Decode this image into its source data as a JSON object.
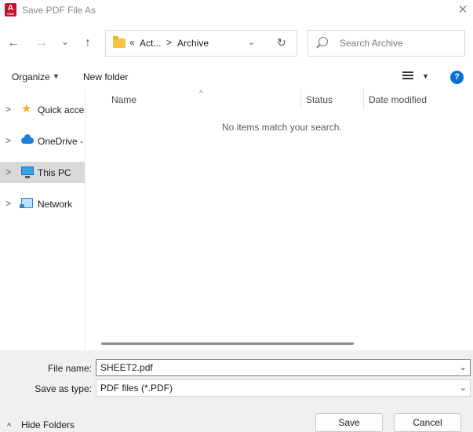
{
  "window": {
    "title": "Save PDF File As",
    "app_icon_letter": "A",
    "app_icon_sub": "CAD",
    "close_glyph": "✕"
  },
  "nav": {
    "back_glyph": "←",
    "forward_glyph": "→",
    "recent_glyph": "⌄",
    "up_glyph": "↑"
  },
  "address": {
    "overflow_glyph": "«",
    "crumb1": "Act...",
    "separator": ">",
    "crumb2": "Archive",
    "dropdown_glyph": "⌄",
    "refresh_glyph": "↻"
  },
  "search": {
    "placeholder": "Search Archive"
  },
  "toolbar": {
    "organize_label": "Organize",
    "caret": "▼",
    "new_folder_label": "New folder",
    "help_label": "?"
  },
  "sidebar": {
    "items": [
      {
        "label": "Quick access",
        "icon": "star-icon"
      },
      {
        "label": "OneDrive - ",
        "icon": "cloud-icon"
      },
      {
        "label": "This PC",
        "icon": "computer-icon",
        "selected": true
      },
      {
        "label": "Network",
        "icon": "network-icon"
      }
    ],
    "chevron_glyph": ">"
  },
  "filelist": {
    "columns": [
      "Name",
      "Status",
      "Date modified"
    ],
    "sort_glyph": "^",
    "empty_message": "No items match your search."
  },
  "form": {
    "file_name_label": "File name:",
    "file_name_value": "SHEET2.pdf",
    "save_type_label": "Save as type:",
    "save_type_value": "PDF files (*.PDF)",
    "dropdown_glyph": "⌄"
  },
  "footer": {
    "hide_folders_glyph": "^",
    "hide_folders_label": "Hide Folders",
    "save_label": "Save",
    "cancel_label": "Cancel"
  }
}
